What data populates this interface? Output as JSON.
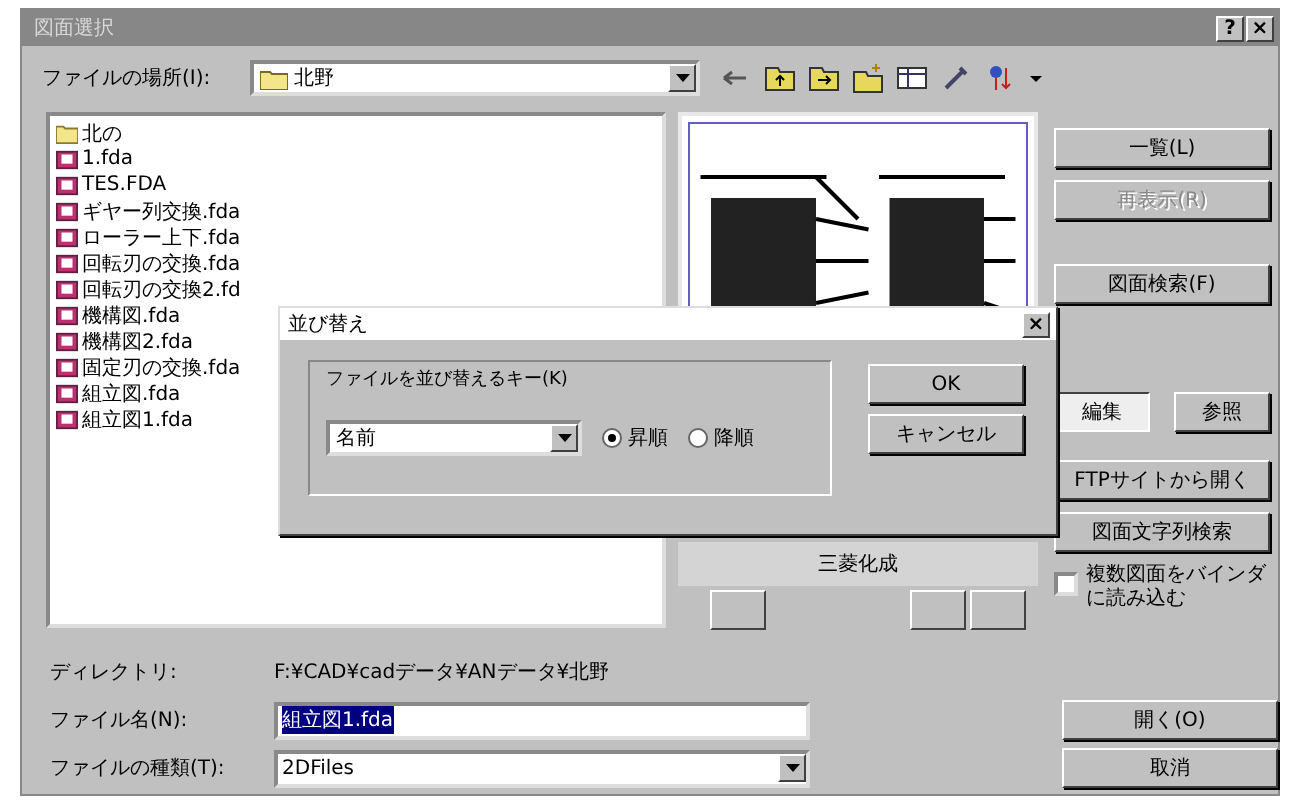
{
  "window": {
    "title": "図面選択",
    "help": "?",
    "close": "×"
  },
  "location": {
    "label": "ファイルの場所(I):",
    "value": "北野"
  },
  "files": [
    {
      "name": "北の",
      "kind": "folder"
    },
    {
      "name": "1.fda",
      "kind": "file"
    },
    {
      "name": "TES.FDA",
      "kind": "file"
    },
    {
      "name": "ギヤー列交換.fda",
      "kind": "file"
    },
    {
      "name": "ローラー上下.fda",
      "kind": "file"
    },
    {
      "name": "回転刃の交換.fda",
      "kind": "file"
    },
    {
      "name": "回転刃の交換2.fd",
      "kind": "file"
    },
    {
      "name": "機構図.fda",
      "kind": "file"
    },
    {
      "name": "機構図2.fda",
      "kind": "file"
    },
    {
      "name": "固定刃の交換.fda",
      "kind": "file"
    },
    {
      "name": "組立図.fda",
      "kind": "file"
    },
    {
      "name": "組立図1.fda",
      "kind": "file"
    }
  ],
  "preview": {
    "caption": "三菱化成"
  },
  "side_buttons": [
    {
      "label": "一覧(L)",
      "disabled": false
    },
    {
      "label": "再表示(R)",
      "disabled": true
    },
    {
      "label": "図面検索(F)",
      "disabled": false
    }
  ],
  "mode_buttons": [
    {
      "label": "編集",
      "selected": true
    },
    {
      "label": "参照",
      "selected": false
    }
  ],
  "tool_buttons": [
    "FTPサイトから開く",
    "図面文字列検索"
  ],
  "binder_checkbox": {
    "label": "複数図面をバインダに読み込む",
    "checked": false
  },
  "directory": {
    "label": "ディレクトリ:",
    "value": "F:¥CAD¥cadデータ¥ANデータ¥北野"
  },
  "filename": {
    "label": "ファイル名(N):",
    "value": "組立図1.fda"
  },
  "filetype": {
    "label": "ファイルの種類(T):",
    "value": "2DFiles"
  },
  "actions": [
    "開く(O)",
    "取消"
  ],
  "sort_dialog": {
    "title": "並び替え",
    "close": "×",
    "group": "ファイルを並び替えるキー(K)",
    "key": "名前",
    "orders": [
      {
        "label": "昇順",
        "selected": true
      },
      {
        "label": "降順",
        "selected": false
      }
    ],
    "buttons": [
      "OK",
      "キャンセル"
    ]
  }
}
